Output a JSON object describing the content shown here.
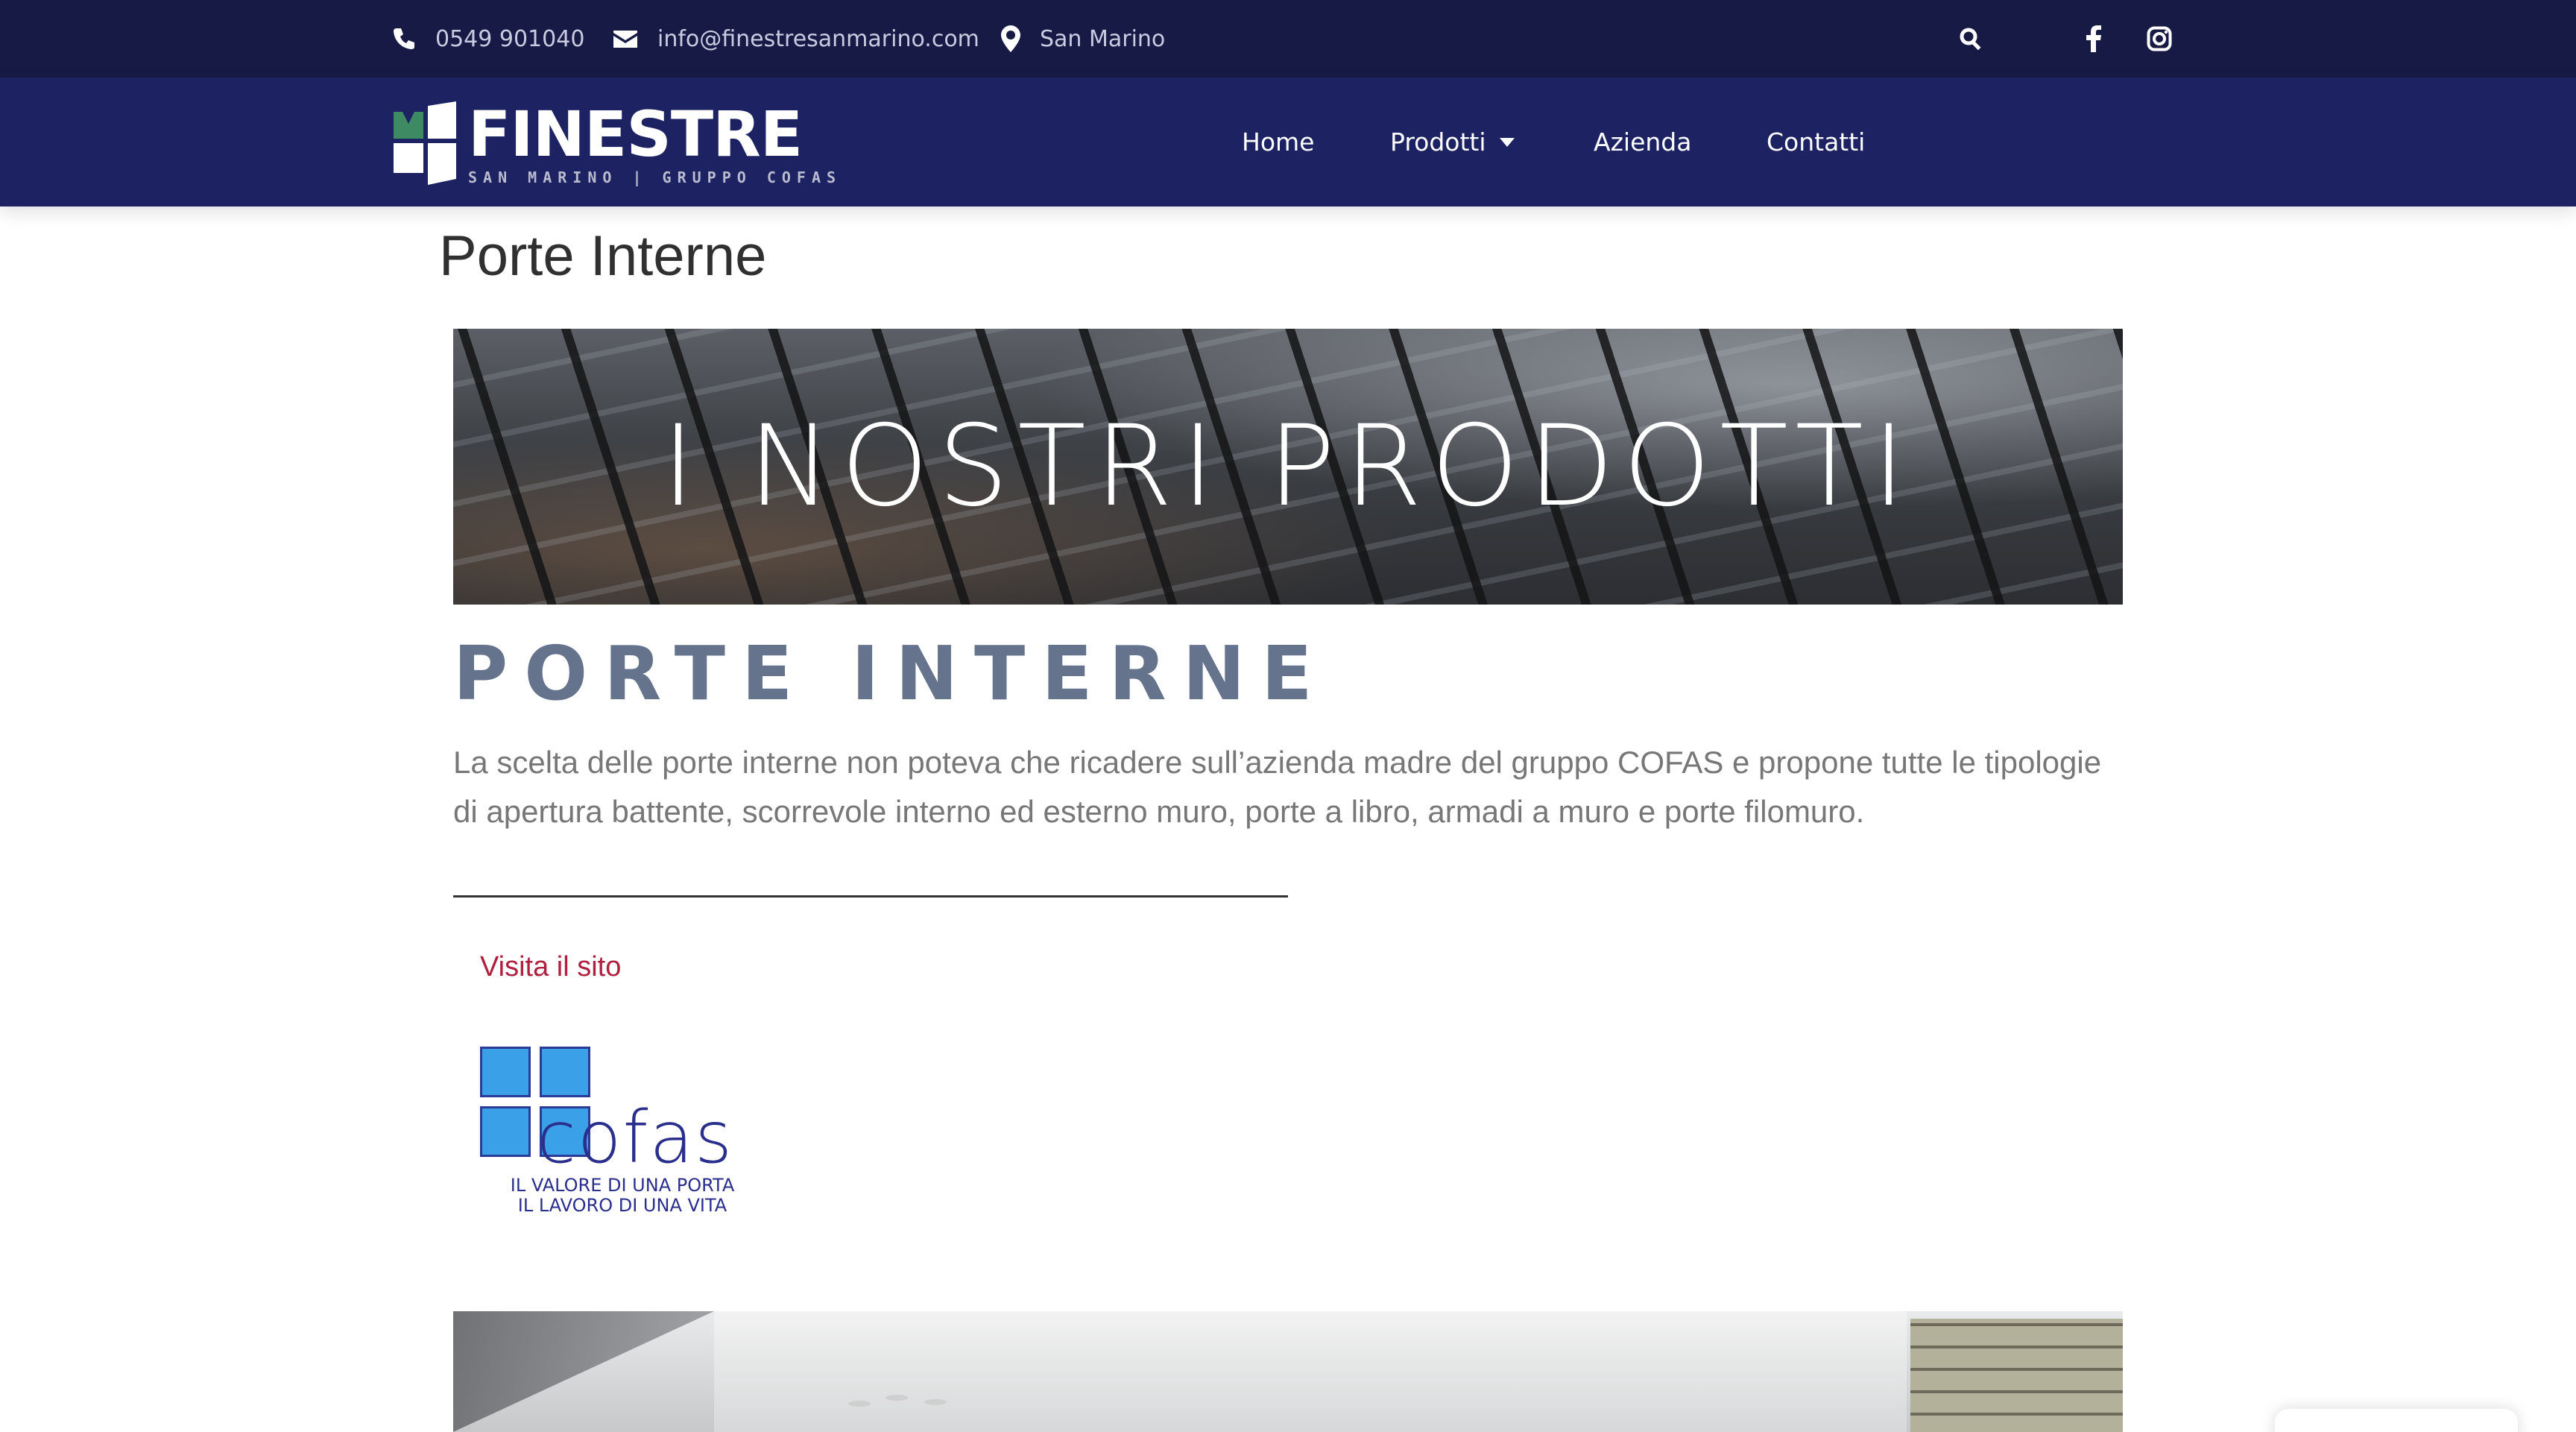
{
  "topbar": {
    "phone": "0549 901040",
    "email": "info@finestresanmarino.com",
    "location": "San Marino",
    "icons": [
      "phone-icon",
      "envelope-icon",
      "map-marker-icon",
      "search-icon",
      "facebook-icon",
      "instagram-icon"
    ]
  },
  "brand": {
    "name": "FINESTRE",
    "subtitle": "SAN MARINO | GRUPPO COFAS",
    "colors": {
      "topbar": "#171a45",
      "navbar": "#1d2262",
      "accent_link": "#b0203e",
      "heading": "#66738c",
      "logo_green": "#3d8a63"
    }
  },
  "nav": {
    "items": [
      {
        "label": "Home"
      },
      {
        "label": "Prodotti"
      },
      {
        "label": "Azienda"
      },
      {
        "label": "Contatti"
      }
    ]
  },
  "page": {
    "title": "Porte Interne",
    "hero_title": "I NOSTRI PRODOTTI",
    "section_title": "PORTE INTERNE",
    "description": "La scelta delle porte interne non poteva che ricadere sull’azienda madre del gruppo COFAS e propone tutte le tipologie di apertura battente, scorrevole interno ed esterno muro, porte a libro, armadi a muro e porte filomuro.",
    "visit_link": "Visita il sito"
  },
  "partner_logo": {
    "brand": "cofas",
    "tagline_1": "IL VALORE DI UNA PORTA",
    "tagline_2": "IL LAVORO DI UNA VITA"
  }
}
